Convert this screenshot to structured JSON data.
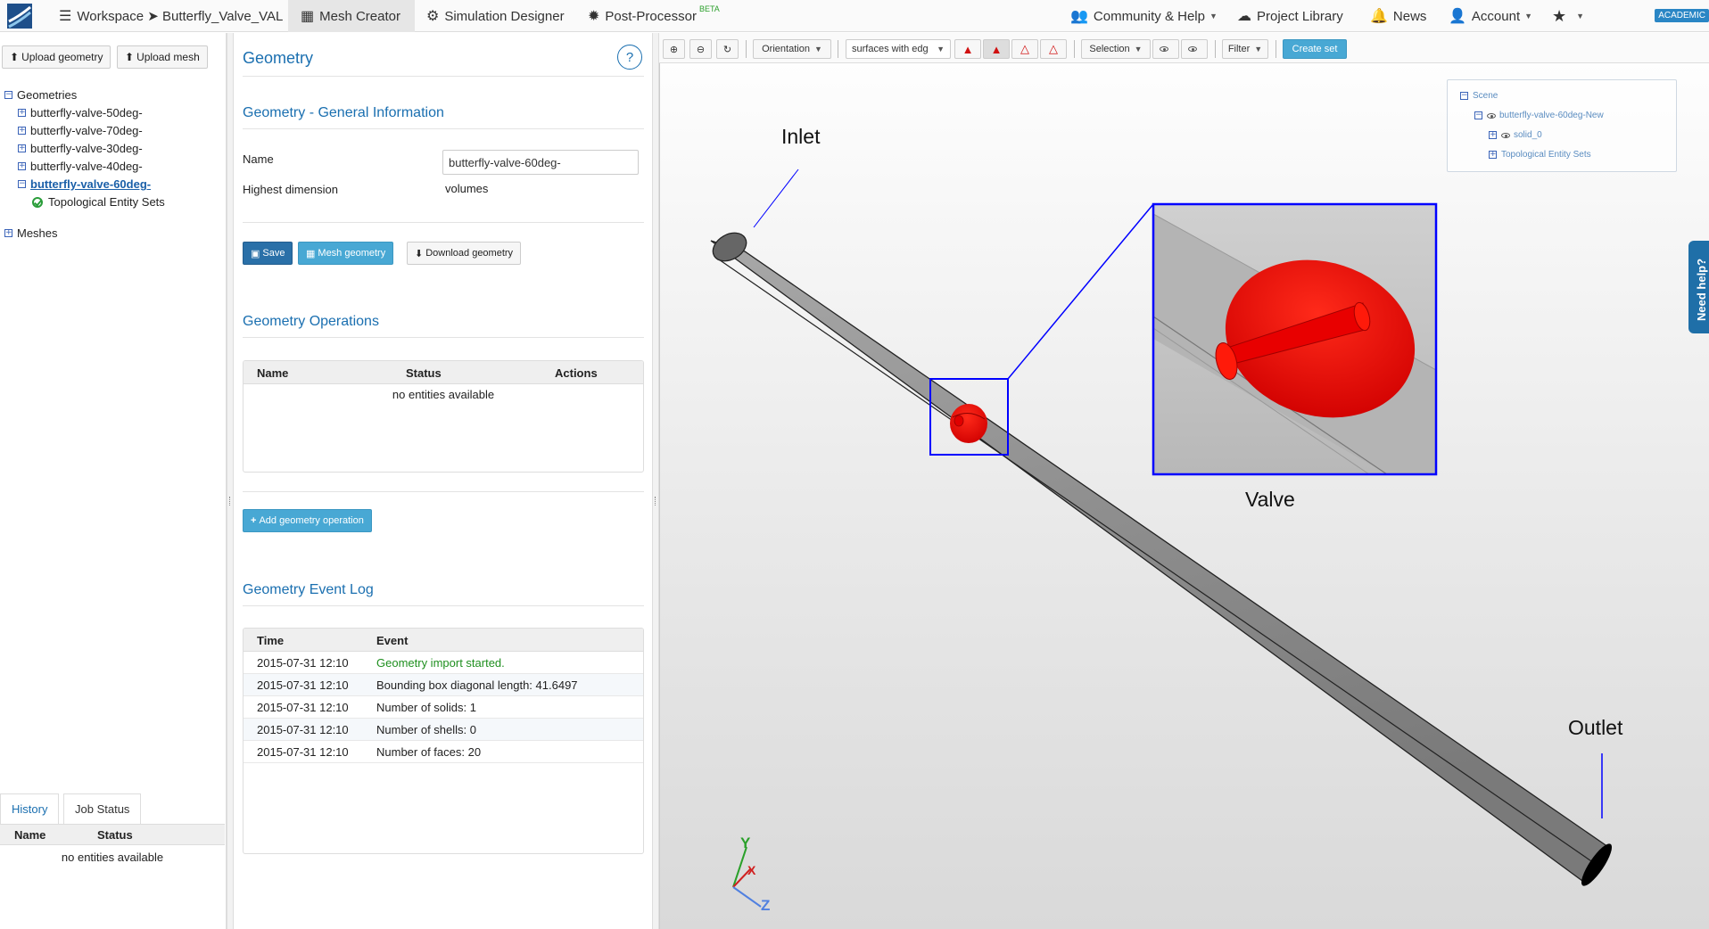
{
  "navbar": {
    "workspace_label": "Workspace ➤ Butterfly_Valve_VAL",
    "mesh_creator": "Mesh Creator",
    "simulation_designer": "Simulation Designer",
    "post_processor": "Post-Processor",
    "beta": "BETA",
    "community_help": "Community & Help",
    "project_library": "Project Library",
    "news": "News",
    "account": "Account",
    "academic": "ACADEMIC"
  },
  "left_panel": {
    "upload_geometry": "Upload geometry",
    "upload_mesh": "Upload mesh",
    "tree": {
      "geometries": "Geometries",
      "items": [
        "butterfly-valve-50deg-",
        "butterfly-valve-70deg-",
        "butterfly-valve-30deg-",
        "butterfly-valve-40deg-"
      ],
      "selected": "butterfly-valve-60deg-",
      "topological": "Topological Entity Sets",
      "meshes": "Meshes"
    },
    "tabs": {
      "history": "History",
      "job_status": "Job Status"
    },
    "history_table": {
      "col_name": "Name",
      "col_status": "Status",
      "empty": "no entities available"
    }
  },
  "geometry_panel": {
    "title": "Geometry",
    "help": "?",
    "general_info_title": "Geometry - General Information",
    "name_label": "Name",
    "name_value": "butterfly-valve-60deg-",
    "highest_dim_label": "Highest dimension",
    "highest_dim_value": "volumes",
    "save": "Save",
    "mesh_geometry": "Mesh geometry",
    "download_geometry": "Download geometry",
    "operations_title": "Geometry Operations",
    "ops_table": {
      "col_name": "Name",
      "col_status": "Status",
      "col_actions": "Actions",
      "empty": "no entities available"
    },
    "add_operation": "Add geometry operation",
    "event_log_title": "Geometry Event Log",
    "log_table": {
      "col_time": "Time",
      "col_event": "Event",
      "rows": [
        {
          "time": "2015-07-31 12:10",
          "event": "Geometry import started."
        },
        {
          "time": "2015-07-31 12:10",
          "event": "Bounding box diagonal length: 41.6497"
        },
        {
          "time": "2015-07-31 12:10",
          "event": "Number of solids: 1"
        },
        {
          "time": "2015-07-31 12:10",
          "event": "Number of shells: 0"
        },
        {
          "time": "2015-07-31 12:10",
          "event": "Number of faces: 20"
        }
      ]
    }
  },
  "toolbar": {
    "orientation": "Orientation",
    "render_mode": "surfaces with edg",
    "selection": "Selection",
    "filter": "Filter",
    "create_set": "Create set"
  },
  "scene_tree": {
    "scene": "Scene",
    "model": "butterfly-valve-60deg-New",
    "solid": "solid_0",
    "topological": "Topological Entity Sets"
  },
  "viewport": {
    "inlet": "Inlet",
    "valve": "Valve",
    "outlet": "Outlet",
    "axis_y": "Y",
    "axis_x": "X",
    "axis_z": "Z",
    "need_help": "Need help?"
  },
  "colors": {
    "accent": "#1a6fb0",
    "valve": "#e00000",
    "highlight_box": "#0000ff"
  }
}
